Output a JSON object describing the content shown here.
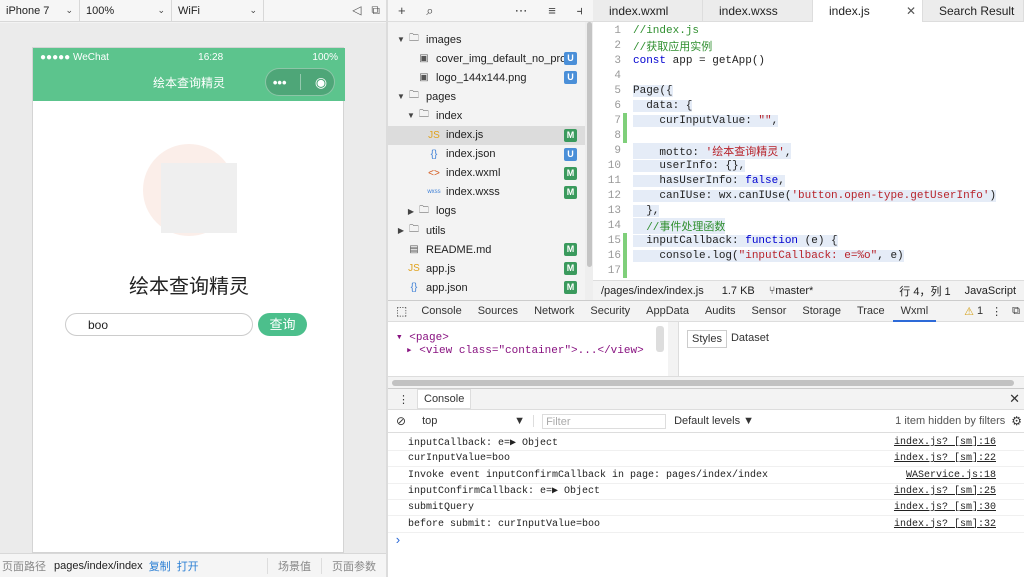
{
  "simulator": {
    "device": "iPhone 7",
    "zoom": "100%",
    "network": "WiFi",
    "status_left": "●●●●● WeChat",
    "time": "16:28",
    "battery": "100%",
    "nav_title": "绘本查询精灵",
    "app_title": "绘本查询精灵",
    "search_value": "boo",
    "search_button": "查询",
    "footer": {
      "path_label": "页面路径",
      "path": "pages/index/index",
      "copy": "复制",
      "open": "打开",
      "scene": "场景值",
      "params": "页面参数"
    }
  },
  "file_tree": {
    "items": [
      {
        "name": "images",
        "type": "folder",
        "open": true,
        "level": 0
      },
      {
        "name": "cover_img_default_no_pro...",
        "type": "image",
        "level": 1,
        "badge": "U"
      },
      {
        "name": "logo_144x144.png",
        "type": "image",
        "level": 1,
        "badge": "U"
      },
      {
        "name": "pages",
        "type": "folder",
        "open": true,
        "level": 0
      },
      {
        "name": "index",
        "type": "folder",
        "open": true,
        "level": 1
      },
      {
        "name": "index.js",
        "type": "js",
        "level": 2,
        "badge": "M",
        "selected": true
      },
      {
        "name": "index.json",
        "type": "json",
        "level": 2,
        "badge": "U"
      },
      {
        "name": "index.wxml",
        "type": "wxml",
        "level": 2,
        "badge": "M"
      },
      {
        "name": "index.wxss",
        "type": "wxss",
        "level": 2,
        "badge": "M"
      },
      {
        "name": "logs",
        "type": "folder",
        "open": false,
        "level": 1
      },
      {
        "name": "utils",
        "type": "folder",
        "open": false,
        "level": 0
      },
      {
        "name": "README.md",
        "type": "file",
        "level": 0,
        "badge": "M"
      },
      {
        "name": "app.js",
        "type": "js",
        "level": 0,
        "badge": "M"
      },
      {
        "name": "app.json",
        "type": "json",
        "level": 0,
        "badge": "M"
      }
    ]
  },
  "editor": {
    "tabs": [
      {
        "label": "index.wxml"
      },
      {
        "label": "index.wxss"
      },
      {
        "label": "index.js",
        "active": true
      },
      {
        "label": "Search Result"
      }
    ],
    "lines": [
      {
        "n": "1",
        "text": "//index.js"
      },
      {
        "n": "2",
        "text": "//获取应用实例"
      },
      {
        "n": "3",
        "text": "const app = getApp()"
      },
      {
        "n": "4",
        "text": ""
      },
      {
        "n": "5",
        "text": "Page({"
      },
      {
        "n": "6",
        "text": "  data: {"
      },
      {
        "n": "7",
        "text": "    curInputValue: \"\","
      },
      {
        "n": "8",
        "text": ""
      },
      {
        "n": "9",
        "text": "    motto: '绘本查询精灵',"
      },
      {
        "n": "10",
        "text": "    userInfo: {},"
      },
      {
        "n": "11",
        "text": "    hasUserInfo: false,"
      },
      {
        "n": "12",
        "text": "    canIUse: wx.canIUse('button.open-type.getUserInfo')"
      },
      {
        "n": "13",
        "text": "  },"
      },
      {
        "n": "14",
        "text": "  //事件处理函数"
      },
      {
        "n": "15",
        "text": "  inputCallback: function (e) {"
      },
      {
        "n": "16",
        "text": "    console.log(\"inputCallback: e=%o\", e)"
      },
      {
        "n": "17",
        "text": ""
      }
    ],
    "status": {
      "path": "/pages/index/index.js",
      "size": "1.7 KB",
      "branch": "master*",
      "position": "行 4，列 1",
      "language": "JavaScript"
    }
  },
  "devtools": {
    "tabs": [
      "Console",
      "Sources",
      "Network",
      "Security",
      "AppData",
      "Audits",
      "Sensor",
      "Storage",
      "Trace",
      "Wxml"
    ],
    "active_tab": "Wxml",
    "warnings": "1",
    "wxml_lines": [
      "<page>",
      "<view class=\"container\">...</view>"
    ],
    "style_tabs": [
      "Styles",
      "Dataset"
    ]
  },
  "console": {
    "title": "Console",
    "context": "top",
    "filter_placeholder": "Filter",
    "levels": "Default levels ▼",
    "hidden": "1 item hidden by filters",
    "logs": [
      {
        "text": "inputCallback: e=▶ Object",
        "src": "index.js? [sm]:16"
      },
      {
        "text": "curInputValue=boo",
        "src": "index.js? [sm]:22"
      },
      {
        "text": "Invoke event inputConfirmCallback in page: pages/index/index",
        "src": "WAService.js:18"
      },
      {
        "text": "inputConfirmCallback: e=▶ Object",
        "src": "index.js? [sm]:25"
      },
      {
        "text": "submitQuery",
        "src": "index.js? [sm]:30"
      },
      {
        "text": "before submit: curInputValue=boo",
        "src": "index.js? [sm]:32"
      }
    ],
    "prompt": "›"
  }
}
